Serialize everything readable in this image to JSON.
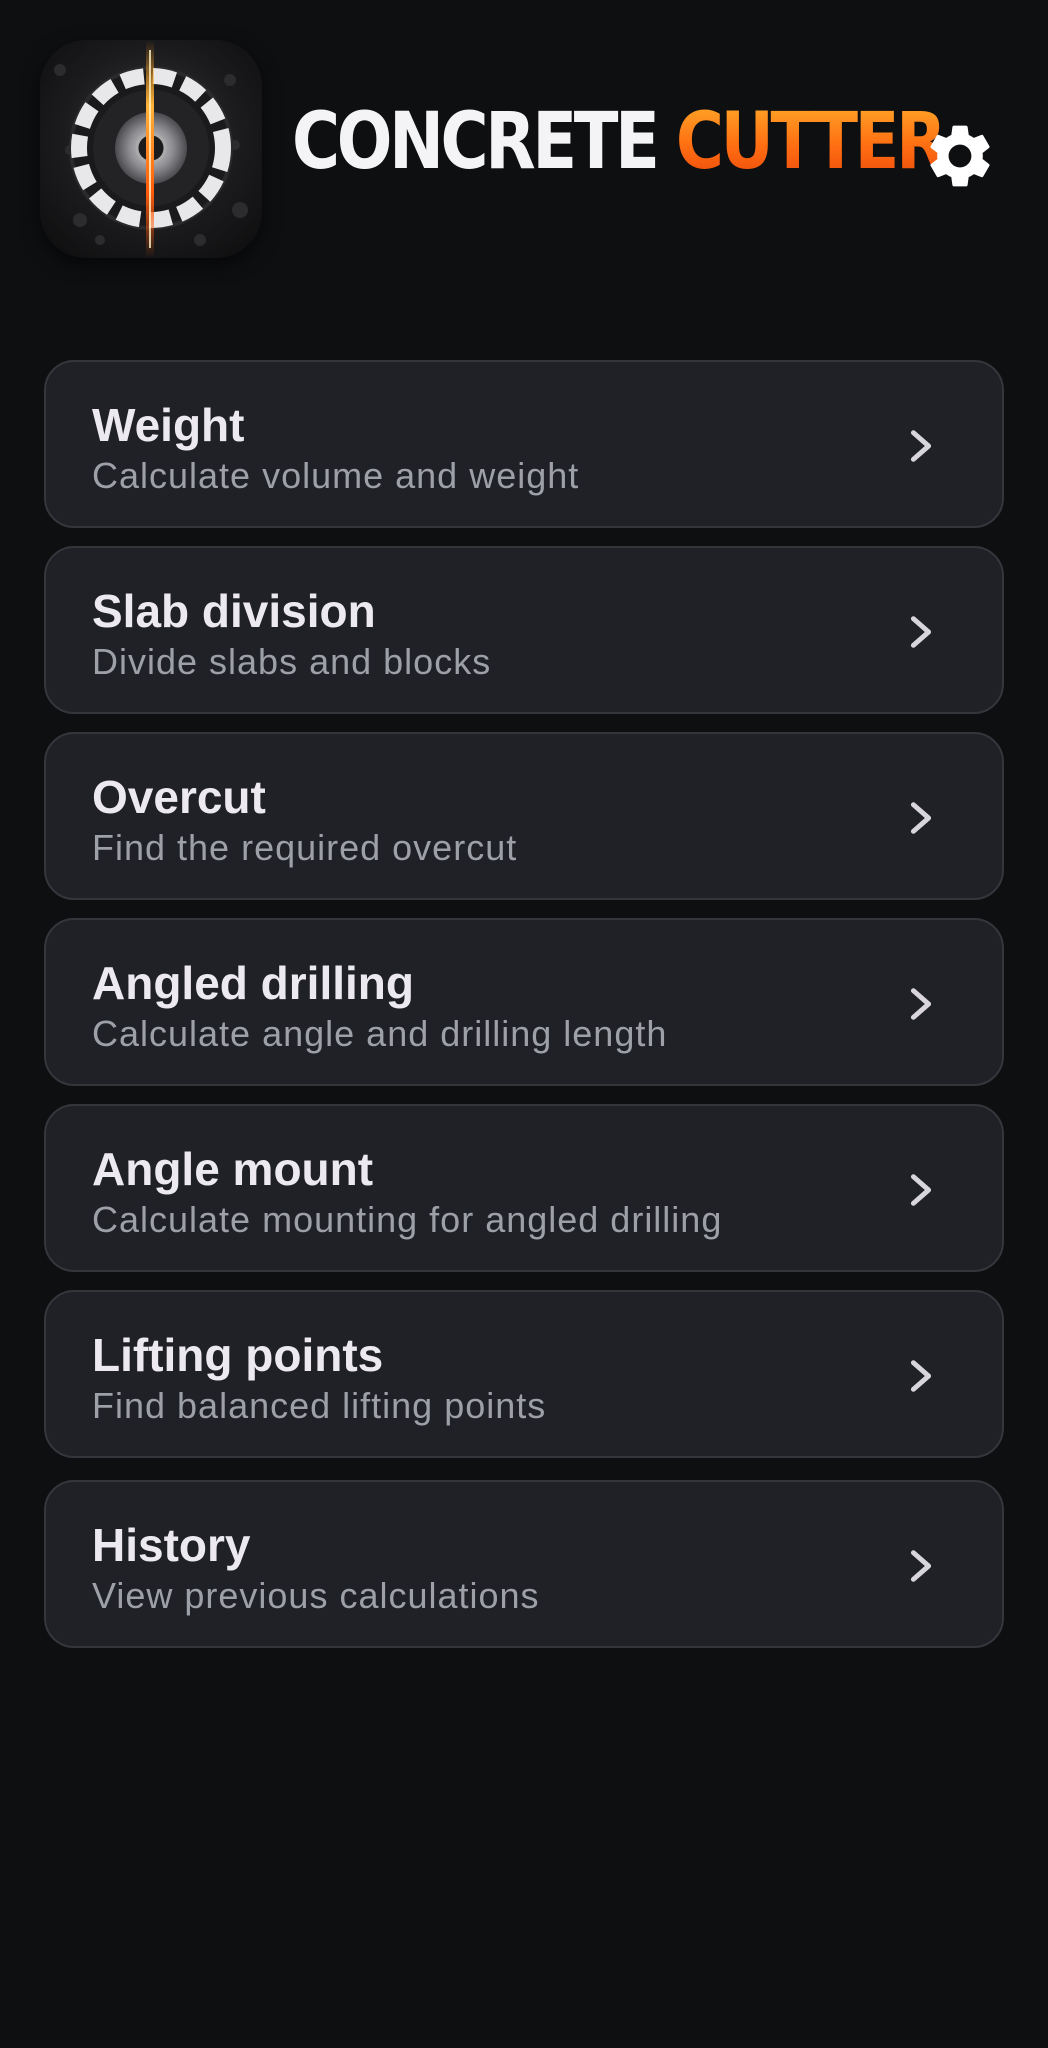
{
  "app": {
    "title_part1": "CONCRETE",
    "title_part2": "CUTTER",
    "icon": "concrete-core-drill-logo",
    "settings_icon": "gear-icon"
  },
  "colors": {
    "background": "#0e0f11",
    "card": "#1f2126",
    "card_border": "#34363c",
    "accent": "#ff6d12",
    "title_text": "#ece9f0",
    "subtitle_text": "#9ea0a8"
  },
  "menu": {
    "items": [
      {
        "title": "Weight",
        "subtitle": "Calculate volume and weight",
        "icon": "chevron-right-icon"
      },
      {
        "title": "Slab division",
        "subtitle": "Divide slabs and blocks",
        "icon": "chevron-right-icon"
      },
      {
        "title": "Overcut",
        "subtitle": "Find the required overcut",
        "icon": "chevron-right-icon"
      },
      {
        "title": "Angled drilling",
        "subtitle": "Calculate angle and drilling length",
        "icon": "chevron-right-icon"
      },
      {
        "title": "Angle mount",
        "subtitle": "Calculate mounting for angled drilling",
        "icon": "chevron-right-icon"
      },
      {
        "title": "Lifting points",
        "subtitle": "Find balanced lifting points",
        "icon": "chevron-right-icon"
      }
    ],
    "history": {
      "title": "History",
      "subtitle": "View previous calculations",
      "icon": "chevron-right-icon"
    }
  }
}
